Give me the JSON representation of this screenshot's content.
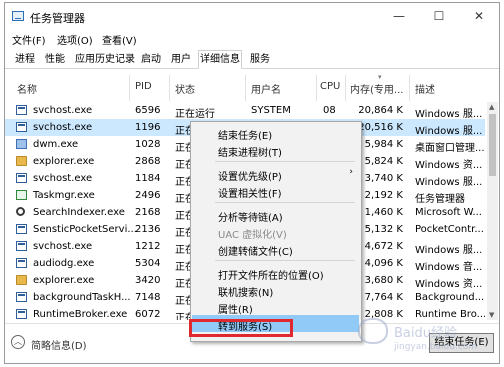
{
  "window": {
    "title": "任务管理器",
    "controls": [
      "—",
      "☐",
      "✕"
    ]
  },
  "menu": {
    "items": [
      "文件(F)",
      "选项(O)",
      "查看(V)"
    ]
  },
  "tabs": [
    {
      "label": "进程"
    },
    {
      "label": "性能"
    },
    {
      "label": "应用历史记录"
    },
    {
      "label": "启动"
    },
    {
      "label": "用户"
    },
    {
      "label": "详细信息",
      "active": true
    },
    {
      "label": "服务"
    }
  ],
  "columns": [
    "名称",
    "PID",
    "状态",
    "用户名",
    "CPU",
    "内存(专用...",
    "描述"
  ],
  "rows": [
    {
      "icon": "service-icon",
      "name": "svchost.exe",
      "pid": "6596",
      "status": "正在运行",
      "user": "SYSTEM",
      "cpu": "08",
      "mem": "20,864 K",
      "desc": "Windows 服..."
    },
    {
      "icon": "service-icon",
      "name": "svchost.exe",
      "pid": "1196",
      "status": "正在运行",
      "user": "SYSTEM",
      "cpu": "00",
      "mem": "20,516 K",
      "desc": "Windows 服...",
      "selected": true
    },
    {
      "icon": "dwm-icon",
      "name": "dwm.exe",
      "pid": "1028",
      "status": "正在",
      "user": "",
      "cpu": "",
      "mem": "5,984 K",
      "desc": "桌面窗口管理..."
    },
    {
      "icon": "folder-icon",
      "name": "explorer.exe",
      "pid": "2868",
      "status": "正在",
      "user": "",
      "cpu": "",
      "mem": "5,824 K",
      "desc": "Windows 资..."
    },
    {
      "icon": "service-icon",
      "name": "svchost.exe",
      "pid": "1184",
      "status": "正在",
      "user": "",
      "cpu": "",
      "mem": "3,740 K",
      "desc": "Windows 服..."
    },
    {
      "icon": "taskmgr-icon",
      "name": "Taskmgr.exe",
      "pid": "2496",
      "status": "正在",
      "user": "",
      "cpu": "",
      "mem": "2,192 K",
      "desc": "任务管理器"
    },
    {
      "icon": "search-icon",
      "name": "SearchIndexer.exe",
      "pid": "2168",
      "status": "正在",
      "user": "",
      "cpu": "",
      "mem": "1,460 K",
      "desc": "Microsoft W..."
    },
    {
      "icon": "service-icon",
      "name": "SensticPocketServi...",
      "pid": "2136",
      "status": "正在",
      "user": "",
      "cpu": "",
      "mem": "5,132 K",
      "desc": "PocketContr..."
    },
    {
      "icon": "service-icon",
      "name": "svchost.exe",
      "pid": "1212",
      "status": "正在",
      "user": "",
      "cpu": "",
      "mem": "4,672 K",
      "desc": "Windows 服..."
    },
    {
      "icon": "service-icon",
      "name": "audiodg.exe",
      "pid": "5304",
      "status": "正在",
      "user": "",
      "cpu": "",
      "mem": "4,096 K",
      "desc": "Windows 音..."
    },
    {
      "icon": "folder-icon",
      "name": "explorer.exe",
      "pid": "3420",
      "status": "正在",
      "user": "",
      "cpu": "",
      "mem": "3,680 K",
      "desc": "Windows 资..."
    },
    {
      "icon": "service-icon",
      "name": "backgroundTaskH...",
      "pid": "7148",
      "status": "正在",
      "user": "",
      "cpu": "",
      "mem": "7,764 K",
      "desc": "Background..."
    },
    {
      "icon": "service-icon",
      "name": "RuntimeBroker.exe",
      "pid": "6072",
      "status": "正在",
      "user": "",
      "cpu": "",
      "mem": "2,808 K",
      "desc": "Runtime Bro..."
    }
  ],
  "context_menu": {
    "items": [
      {
        "label": "结束任务(E)"
      },
      {
        "label": "结束进程树(T)"
      },
      {
        "separator": true
      },
      {
        "label": "设置优先级(P)",
        "submenu": true
      },
      {
        "label": "设置相关性(F)"
      },
      {
        "separator": true
      },
      {
        "label": "分析等待链(A)"
      },
      {
        "label": "UAC 虚拟化(V)",
        "disabled": true
      },
      {
        "label": "创建转储文件(C)"
      },
      {
        "separator": true
      },
      {
        "label": "打开文件所在的位置(O)"
      },
      {
        "label": "联机搜索(N)"
      },
      {
        "label": "属性(R)"
      },
      {
        "label": "转到服务(S)",
        "highlighted": true
      }
    ]
  },
  "footer": {
    "fewer_details": "简略信息(D)",
    "end_task": "结束任务(E)"
  },
  "watermark": {
    "text": "Baidu经验",
    "subtext": "jingyan.baidu.com"
  },
  "colors": {
    "selection": "#cce8ff",
    "menu_highlight": "#91c9f7",
    "annotation_red": "#e0292e"
  }
}
